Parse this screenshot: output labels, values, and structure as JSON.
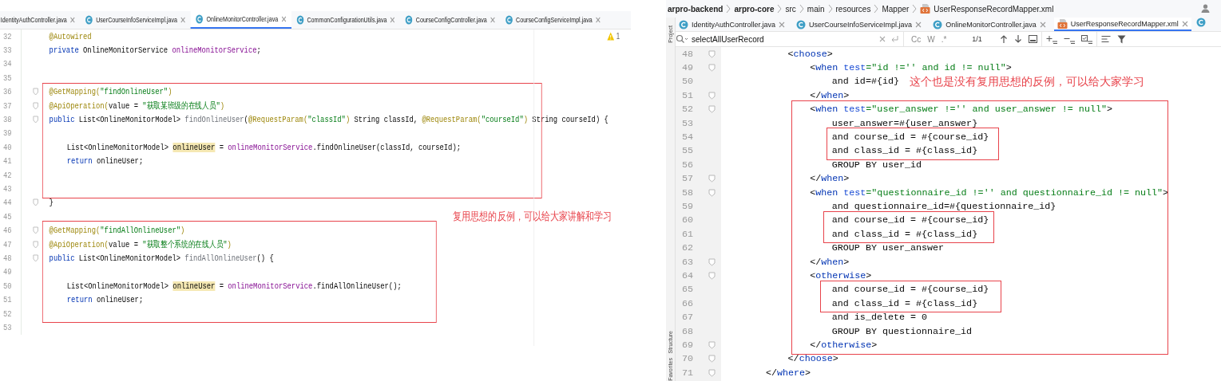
{
  "left_editor": {
    "tabs": [
      {
        "label": "IdentityAuthController.java",
        "selected": false
      },
      {
        "label": "UserCourseInfoServiceImpl.java",
        "selected": false
      },
      {
        "label": "OnlineMonitorController.java",
        "selected": true
      },
      {
        "label": "CommonConfigurationUtils.java",
        "selected": false
      },
      {
        "label": "CourseConfigController.java",
        "selected": false
      },
      {
        "label": "CourseConfigServiceImpl.java",
        "selected": false
      }
    ],
    "warning_count": "1",
    "blocks": [
      {
        "framed": false,
        "items": [
          {
            "kind": "line",
            "number": "32",
            "tokens": [
              {
                "text": "@Autowired",
                "kind": "annotation"
              }
            ]
          },
          {
            "kind": "line",
            "number": "33",
            "tokens": [
              {
                "text": "private",
                "kind": "keyword"
              },
              {
                "text": " OnlineMonitorService ",
                "kind": "plain"
              },
              {
                "text": "onlineMonitorService",
                "kind": "field"
              },
              {
                "text": ";",
                "kind": "plain"
              }
            ]
          },
          {
            "kind": "line",
            "number": "34"
          },
          {
            "kind": "line",
            "number": "35"
          }
        ]
      },
      {
        "framed": true,
        "items": [
          {
            "kind": "line",
            "number": "36",
            "tokens": [
              {
                "text": "@GetMapping(",
                "kind": "annotation"
              },
              {
                "text": "\"findOnlineUser\"",
                "kind": "string"
              },
              {
                "text": ")",
                "kind": "annotation"
              }
            ]
          },
          {
            "kind": "line",
            "number": "37",
            "tokens": [
              {
                "text": "@ApiOperation(",
                "kind": "annotation"
              },
              {
                "text": "value = ",
                "kind": "plain"
              },
              {
                "text": "\"获取某班级的在线人员\"",
                "kind": "string"
              },
              {
                "text": ")",
                "kind": "annotation"
              }
            ]
          },
          {
            "kind": "line",
            "number": "38",
            "tokens": [
              {
                "text": "public",
                "kind": "keyword"
              },
              {
                "text": " List<OnlineMonitorModel> ",
                "kind": "plain"
              },
              {
                "text": "findOnlineUser",
                "kind": "declaration"
              },
              {
                "text": "(",
                "kind": "plain"
              },
              {
                "text": "@RequestParam(",
                "kind": "annotation"
              },
              {
                "text": "\"classId\"",
                "kind": "string"
              },
              {
                "text": ")",
                "kind": "annotation"
              },
              {
                "text": " String classId, ",
                "kind": "plain"
              },
              {
                "text": "@RequestParam(",
                "kind": "annotation"
              },
              {
                "text": "\"courseId\"",
                "kind": "string"
              },
              {
                "text": ")",
                "kind": "annotation"
              },
              {
                "text": " String courseId) {",
                "kind": "plain"
              }
            ]
          },
          {
            "kind": "line",
            "number": "39"
          },
          {
            "kind": "line",
            "number": "40",
            "tokens": [
              {
                "text": "List<OnlineMonitorModel> ",
                "kind": "plain"
              },
              {
                "text": "onlineUser",
                "kind": "highlight"
              },
              {
                "text": " = ",
                "kind": "plain"
              },
              {
                "text": "onlineMonitorService",
                "kind": "field"
              },
              {
                "text": ".findOnlineUser(classId, courseId);",
                "kind": "plain"
              }
            ]
          },
          {
            "kind": "line",
            "number": "41",
            "tokens": [
              {
                "text": "return",
                "kind": "keyword"
              },
              {
                "text": " onlineUser;",
                "kind": "plain"
              }
            ]
          },
          {
            "kind": "line",
            "number": "42"
          },
          {
            "kind": "line",
            "number": "43"
          }
        ]
      },
      {
        "framed": false,
        "items": [
          {
            "kind": "line",
            "number": "44",
            "tokens": [
              {
                "text": "}",
                "kind": "plain"
              }
            ]
          },
          {
            "kind": "line",
            "number": "45"
          }
        ]
      },
      {
        "framed": true,
        "items": [
          {
            "kind": "line",
            "number": "46",
            "tokens": [
              {
                "text": "@GetMapping(",
                "kind": "annotation"
              },
              {
                "text": "\"findAllOnlineUser\"",
                "kind": "string"
              },
              {
                "text": ")",
                "kind": "annotation"
              }
            ]
          },
          {
            "kind": "line",
            "number": "47",
            "tokens": [
              {
                "text": "@ApiOperation(",
                "kind": "annotation"
              },
              {
                "text": "value = ",
                "kind": "plain"
              },
              {
                "text": "\"获取整个系统的在线人员\"",
                "kind": "string"
              },
              {
                "text": ")",
                "kind": "annotation"
              }
            ]
          },
          {
            "kind": "line",
            "number": "48",
            "tokens": [
              {
                "text": "public",
                "kind": "keyword"
              },
              {
                "text": " List<OnlineMonitorModel> ",
                "kind": "plain"
              },
              {
                "text": "findAllOnlineUser",
                "kind": "declaration"
              },
              {
                "text": "() {",
                "kind": "plain"
              }
            ]
          },
          {
            "kind": "line",
            "number": "49"
          },
          {
            "kind": "line",
            "number": "50",
            "tokens": [
              {
                "text": "List<OnlineMonitorModel> ",
                "kind": "plain"
              },
              {
                "text": "onlineUser",
                "kind": "highlight"
              },
              {
                "text": " = ",
                "kind": "plain"
              },
              {
                "text": "onlineMonitorService",
                "kind": "field"
              },
              {
                "text": ".findAllOnlineUser();",
                "kind": "plain"
              }
            ]
          },
          {
            "kind": "line",
            "number": "51",
            "tokens": [
              {
                "text": "return",
                "kind": "keyword"
              },
              {
                "text": " onlineUser;",
                "kind": "plain"
              }
            ]
          },
          {
            "kind": "line",
            "number": "52"
          }
        ]
      },
      {
        "framed": false,
        "items": [
          {
            "kind": "line",
            "number": "53"
          }
        ]
      }
    ],
    "note": "复用思想的反例，可以给大家讲解和学习"
  },
  "right_editor": {
    "breadcrumb": [
      {
        "text": "arpro-backend",
        "bold": true
      },
      {
        "text": "arpro-core",
        "bold": true
      },
      {
        "text": "src",
        "bold": false
      },
      {
        "text": "main",
        "bold": false
      },
      {
        "text": "resources",
        "bold": false
      },
      {
        "text": "Mapper",
        "bold": false
      },
      {
        "text": "UserResponseRecordMapper.xml",
        "bold": false
      }
    ],
    "side_tools": [
      "Project",
      "Structure",
      "Favorites"
    ],
    "tabs": [
      {
        "label": "IdentityAuthController.java",
        "kind": "java",
        "selected": false
      },
      {
        "label": "UserCourseInfoServiceImpl.java",
        "kind": "java",
        "selected": false
      },
      {
        "label": "OnlineMonitorController.java",
        "kind": "java",
        "selected": false
      },
      {
        "label": "UserResponseRecordMapper.xml",
        "kind": "xml",
        "selected": true
      }
    ],
    "search": {
      "value": "selectAllUserRecord",
      "options": [
        "Cc",
        "W",
        ".*"
      ],
      "match_count": "1/1"
    },
    "blocks": [
      {
        "framed": false,
        "items": [
          {
            "kind": "line",
            "number": "48",
            "tokens": [
              {
                "text": "<",
                "kind": "plain"
              },
              {
                "text": "choose",
                "kind": "tag"
              },
              {
                "text": ">",
                "kind": "plain"
              }
            ]
          },
          {
            "kind": "line",
            "number": "49",
            "tokens": [
              {
                "text": "<",
                "kind": "plain"
              },
              {
                "text": "when",
                "kind": "tag"
              },
              {
                "text": " test",
                "kind": "attribute"
              },
              {
                "text": "=\"id !='' and id != null\"",
                "kind": "string"
              },
              {
                "text": ">",
                "kind": "plain"
              }
            ]
          },
          {
            "kind": "line",
            "number": "50",
            "tokens": [
              {
                "text": "and id=#{id}",
                "kind": "plain"
              }
            ]
          },
          {
            "kind": "line",
            "number": "51",
            "tokens": [
              {
                "text": "</",
                "kind": "plain"
              },
              {
                "text": "when",
                "kind": "tag"
              },
              {
                "text": ">",
                "kind": "plain"
              }
            ]
          }
        ]
      },
      {
        "framed": true,
        "items": [
          {
            "kind": "line",
            "number": "52",
            "tokens": [
              {
                "text": "<",
                "kind": "plain"
              },
              {
                "text": "when",
                "kind": "tag"
              },
              {
                "text": " test",
                "kind": "attribute"
              },
              {
                "text": "=\"user_answer !='' and user_answer != null\"",
                "kind": "string"
              },
              {
                "text": ">",
                "kind": "plain"
              }
            ]
          },
          {
            "kind": "line",
            "number": "53",
            "tokens": [
              {
                "text": "user_answer=#{user_answer}",
                "kind": "plain"
              }
            ]
          },
          {
            "kind": "group",
            "framed": true,
            "items": [
              {
                "kind": "line",
                "number": "54",
                "tokens": [
                  {
                    "text": "and course_id = #{course_id}",
                    "kind": "plain"
                  }
                ]
              },
              {
                "kind": "line",
                "number": "55",
                "tokens": [
                  {
                    "text": "and class_id = #{class_id}",
                    "kind": "plain"
                  }
                ]
              }
            ]
          },
          {
            "kind": "line",
            "number": "56",
            "tokens": [
              {
                "text": "GROUP BY user_id",
                "kind": "plain"
              }
            ]
          },
          {
            "kind": "line",
            "number": "57",
            "tokens": [
              {
                "text": "</",
                "kind": "plain"
              },
              {
                "text": "when",
                "kind": "tag"
              },
              {
                "text": ">",
                "kind": "plain"
              }
            ]
          },
          {
            "kind": "line",
            "number": "58",
            "tokens": [
              {
                "text": "<",
                "kind": "plain"
              },
              {
                "text": "when",
                "kind": "tag"
              },
              {
                "text": " test",
                "kind": "attribute"
              },
              {
                "text": "=\"questionnaire_id !='' and questionnaire_id != null\"",
                "kind": "string"
              },
              {
                "text": ">",
                "kind": "plain"
              }
            ]
          },
          {
            "kind": "line",
            "number": "59",
            "tokens": [
              {
                "text": "and questionnaire_id=#{questionnaire_id}",
                "kind": "plain"
              }
            ]
          },
          {
            "kind": "group",
            "framed": true,
            "items": [
              {
                "kind": "line",
                "number": "60",
                "tokens": [
                  {
                    "text": "and course_id = #{course_id}",
                    "kind": "plain"
                  }
                ]
              },
              {
                "kind": "line",
                "number": "61",
                "tokens": [
                  {
                    "text": "and class_id = #{class_id}",
                    "kind": "plain"
                  }
                ]
              }
            ]
          },
          {
            "kind": "line",
            "number": "62",
            "tokens": [
              {
                "text": "GROUP BY user_answer",
                "kind": "plain"
              }
            ]
          },
          {
            "kind": "line",
            "number": "63",
            "tokens": [
              {
                "text": "</",
                "kind": "plain"
              },
              {
                "text": "when",
                "kind": "tag"
              },
              {
                "text": ">",
                "kind": "plain"
              }
            ]
          },
          {
            "kind": "line",
            "number": "64",
            "tokens": [
              {
                "text": "<",
                "kind": "plain"
              },
              {
                "text": "otherwise",
                "kind": "tag"
              },
              {
                "text": ">",
                "kind": "plain"
              }
            ]
          },
          {
            "kind": "group",
            "framed": true,
            "items": [
              {
                "kind": "line",
                "number": "65",
                "tokens": [
                  {
                    "text": "and course_id = #{course_id}",
                    "kind": "plain"
                  }
                ]
              },
              {
                "kind": "line",
                "number": "66",
                "tokens": [
                  {
                    "text": "and class_id = #{class_id}",
                    "kind": "plain"
                  }
                ]
              }
            ]
          },
          {
            "kind": "line",
            "number": "67",
            "tokens": [
              {
                "text": "and is_delete = 0",
                "kind": "plain"
              }
            ]
          },
          {
            "kind": "line",
            "number": "68",
            "tokens": [
              {
                "text": "GROUP BY questionnaire_id",
                "kind": "plain"
              }
            ]
          },
          {
            "kind": "line",
            "number": "69",
            "tokens": [
              {
                "text": "</",
                "kind": "plain"
              },
              {
                "text": "otherwise",
                "kind": "tag"
              },
              {
                "text": ">",
                "kind": "plain"
              }
            ]
          }
        ]
      },
      {
        "framed": false,
        "items": [
          {
            "kind": "line",
            "number": "70",
            "tokens": [
              {
                "text": "</",
                "kind": "plain"
              },
              {
                "text": "choose",
                "kind": "tag"
              },
              {
                "text": ">",
                "kind": "plain"
              }
            ]
          },
          {
            "kind": "line",
            "number": "71",
            "tokens": [
              {
                "text": "</",
                "kind": "plain"
              },
              {
                "text": "where",
                "kind": "tag"
              },
              {
                "text": ">",
                "kind": "plain"
              }
            ]
          }
        ]
      }
    ],
    "note": "这个也是没有复用思想的反例，可以给大家学习"
  }
}
